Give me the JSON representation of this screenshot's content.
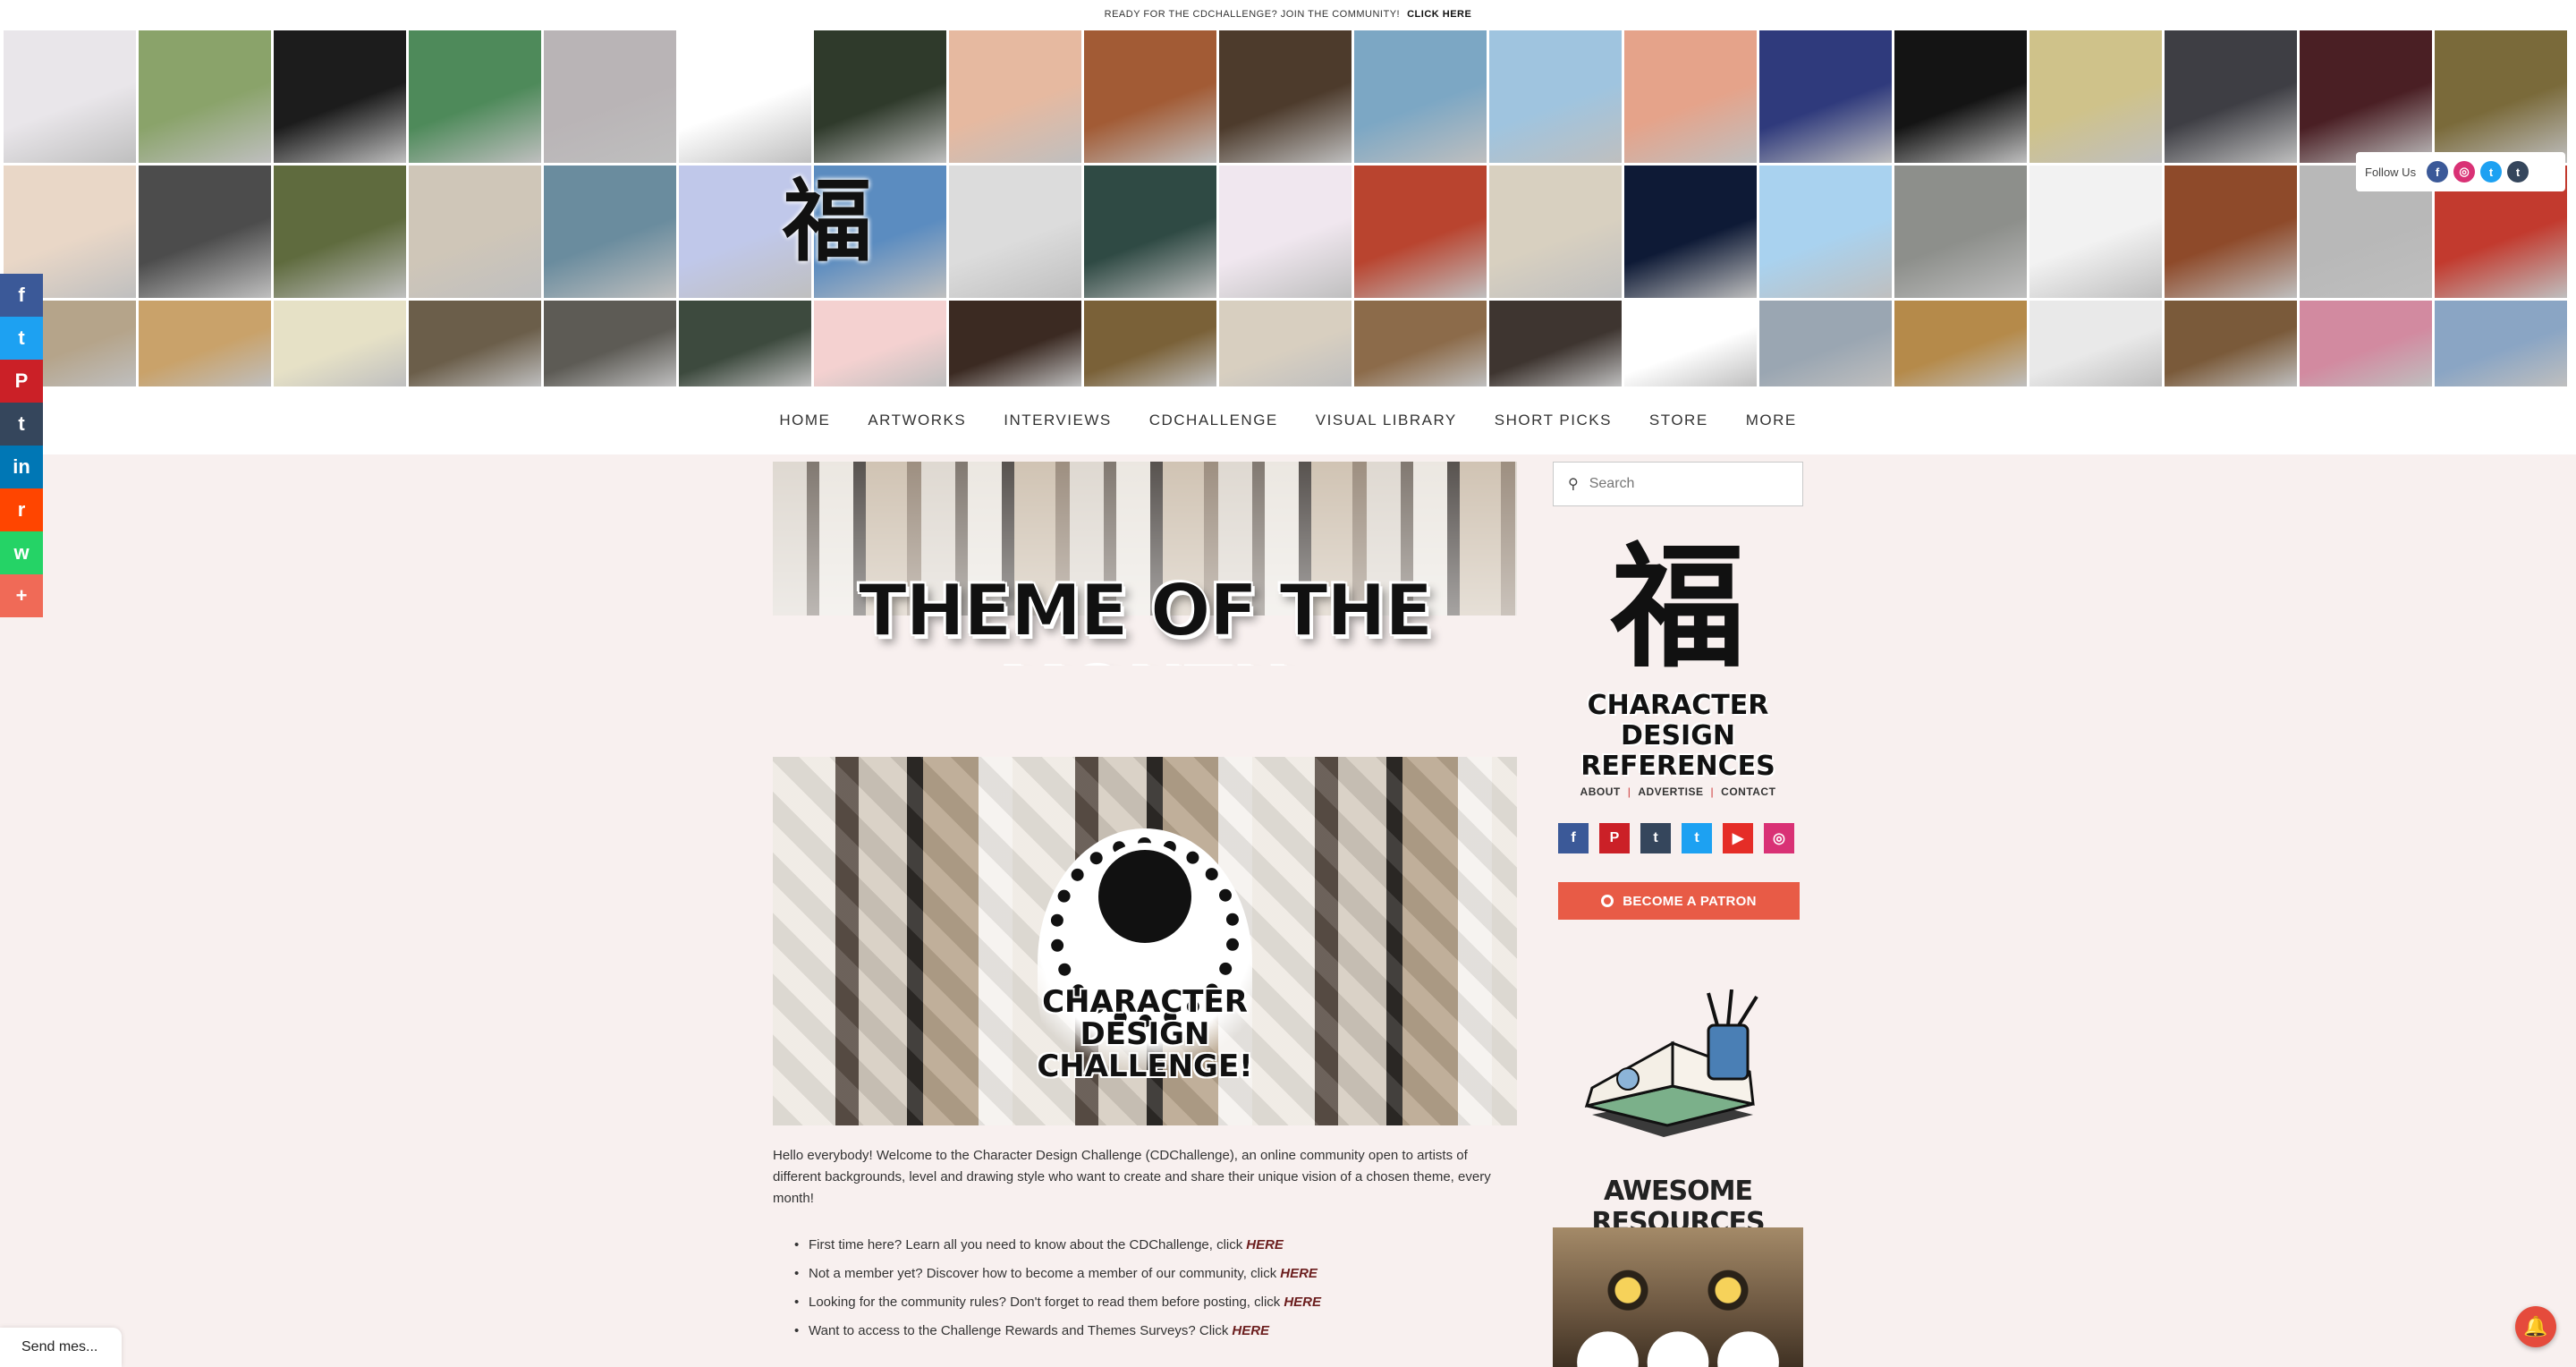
{
  "announcement": {
    "text": "READY FOR THE CDCHALLENGE? JOIN THE COMMUNITY!",
    "cta": "CLICK HERE"
  },
  "header": {
    "site_logo_glyph": "福",
    "follow_label": "Follow Us",
    "follow_icons": [
      "facebook-icon",
      "instagram-icon",
      "twitter-icon",
      "tumblr-icon"
    ],
    "mosaic_colors": [
      "#e9e6ea",
      "#8aa36a",
      "#1c1c1c",
      "#4e8a5a",
      "#b9b4b6",
      "#ffffff",
      "#2f3a2b",
      "#e6b9a0",
      "#a25b35",
      "#4d3b2c",
      "#7ca7c4",
      "#9fc4df",
      "#e5a38a",
      "#2f3a7c",
      "#141414",
      "#cfc28a",
      "#3e3e44",
      "#4a1f24",
      "#7a6a3a",
      "#e9d7c7",
      "#4c4c4c",
      "#5f6b3e",
      "#cfc6b8",
      "#6a8c9e",
      "#c0c8ea",
      "#5b8cc0",
      "#dcdcdc",
      "#2f4a44",
      "#f0e7ef",
      "#b9442f",
      "#d8d0c0",
      "#0e1a36",
      "#a9d2ef",
      "#8d8f8b",
      "#f2f2f2",
      "#8e4a2a",
      "#b8b8b8",
      "#c23a2e",
      "#b5a48a",
      "#c9a26a",
      "#e6e1c6",
      "#6b5e4a",
      "#5d5b55",
      "#3d4a3e",
      "#f4d1d0",
      "#3b2a22",
      "#7a6138",
      "#d8cfc0",
      "#8c6b4a",
      "#3e3530",
      "#ffffff",
      "#9aa6b2",
      "#b58a4a",
      "#e9e9e9",
      "#7a5a3a",
      "#d28aa0",
      "#8aa5c4"
    ]
  },
  "nav": {
    "items": [
      "HOME",
      "ARTWORKS",
      "INTERVIEWS",
      "CDCHALLENGE",
      "VISUAL LIBRARY",
      "SHORT PICKS",
      "STORE",
      "MORE"
    ]
  },
  "share": {
    "items": [
      {
        "name": "facebook-share",
        "glyph": "f",
        "color": "#3b5998"
      },
      {
        "name": "twitter-share",
        "glyph": "t",
        "color": "#1da1f2"
      },
      {
        "name": "pinterest-share",
        "glyph": "P",
        "color": "#cb2027"
      },
      {
        "name": "tumblr-share",
        "glyph": "t",
        "color": "#35465c"
      },
      {
        "name": "linkedin-share",
        "glyph": "in",
        "color": "#0077b5"
      },
      {
        "name": "reddit-share",
        "glyph": "r",
        "color": "#ff4500"
      },
      {
        "name": "whatsapp-share",
        "glyph": "w",
        "color": "#25d366"
      },
      {
        "name": "more-share",
        "glyph": "+",
        "color": "#f06a57"
      }
    ]
  },
  "main": {
    "banner_title": "THEME OF THE MONTH",
    "cdc_emblem_text": "CHARACTER DESIGN CHALLENGE!",
    "intro": "Hello everybody! Welcome to the Character Design Challenge (CDChallenge), an online community open to artists of different backgrounds, level and drawing style who want to create and share their unique vision of a chosen theme, every month!",
    "bullets": [
      {
        "text": "First time here? Learn all you need to know about the CDChallenge, click",
        "link": "HERE"
      },
      {
        "text": "Not a member yet? Discover how to become a member of our community, click",
        "link": "HERE"
      },
      {
        "text": "Looking for the community rules? Don't forget to read them before posting, click",
        "link": "HERE"
      },
      {
        "text": "Want to access to the Challenge Rewards and Themes Surveys? Click",
        "link": "HERE"
      }
    ]
  },
  "sidebar": {
    "search_placeholder": "Search",
    "logo_glyph": "福",
    "logo_text": "CHARACTER DESIGN REFERENCES",
    "links": [
      "ABOUT",
      "ADVERTISE",
      "CONTACT"
    ],
    "social": [
      {
        "name": "facebook-icon",
        "glyph": "f",
        "color": "#3b5998"
      },
      {
        "name": "pinterest-icon",
        "glyph": "P",
        "color": "#cb2027"
      },
      {
        "name": "tumblr-icon",
        "glyph": "t",
        "color": "#35465c"
      },
      {
        "name": "twitter-icon",
        "glyph": "t",
        "color": "#1da1f2"
      },
      {
        "name": "youtube-icon",
        "glyph": "▶",
        "color": "#e52d27"
      },
      {
        "name": "instagram-icon",
        "glyph": "◎",
        "color": "#d93175"
      }
    ],
    "patron_label": "BECOME A PATRON",
    "resources_title": "AWESOME RESOURCES"
  },
  "chat": {
    "send_message": "Send mes..."
  },
  "accent": "#e85b46"
}
